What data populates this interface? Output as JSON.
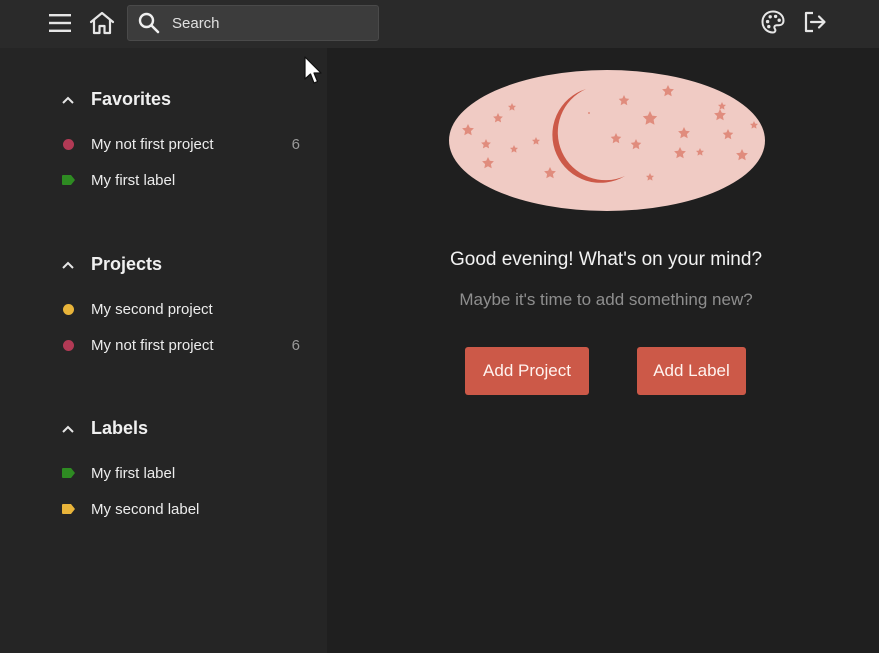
{
  "topbar": {
    "search": {
      "placeholder": "Search"
    },
    "icons": {
      "menu": "hamburger-menu-icon",
      "home": "home-icon",
      "palette": "palette-icon",
      "logout": "logout-icon"
    }
  },
  "sidebar": {
    "favorites": {
      "title": "Favorites",
      "items": [
        {
          "label": "My not first project",
          "count": "6",
          "kind": "project",
          "color": "#b23a55"
        },
        {
          "label": "My first label",
          "count": "",
          "kind": "label",
          "color": "#2e8b22"
        }
      ]
    },
    "projects": {
      "title": "Projects",
      "items": [
        {
          "label": "My second project",
          "count": "",
          "kind": "project",
          "color": "#e8b43a"
        },
        {
          "label": "My not first project",
          "count": "6",
          "kind": "project",
          "color": "#b23a55"
        }
      ]
    },
    "labels": {
      "title": "Labels",
      "items": [
        {
          "label": "My first label",
          "kind": "label",
          "color": "#2e8b22"
        },
        {
          "label": "My second label",
          "kind": "label",
          "color": "#e8b43a"
        }
      ]
    }
  },
  "main": {
    "greeting": "Good evening! What's on your mind?",
    "subtext": "Maybe it's time to add something new?",
    "buttons": {
      "add_project": "Add Project",
      "add_label": "Add Label"
    }
  },
  "colors": {
    "accent": "#cc5948",
    "background": "#1f1f1f",
    "sidebar": "#252525",
    "topbar": "#2a2a2a",
    "hero_bg": "#f0cbc4",
    "hero_moon": "#cc5948",
    "hero_stars": "#e08c7d"
  }
}
